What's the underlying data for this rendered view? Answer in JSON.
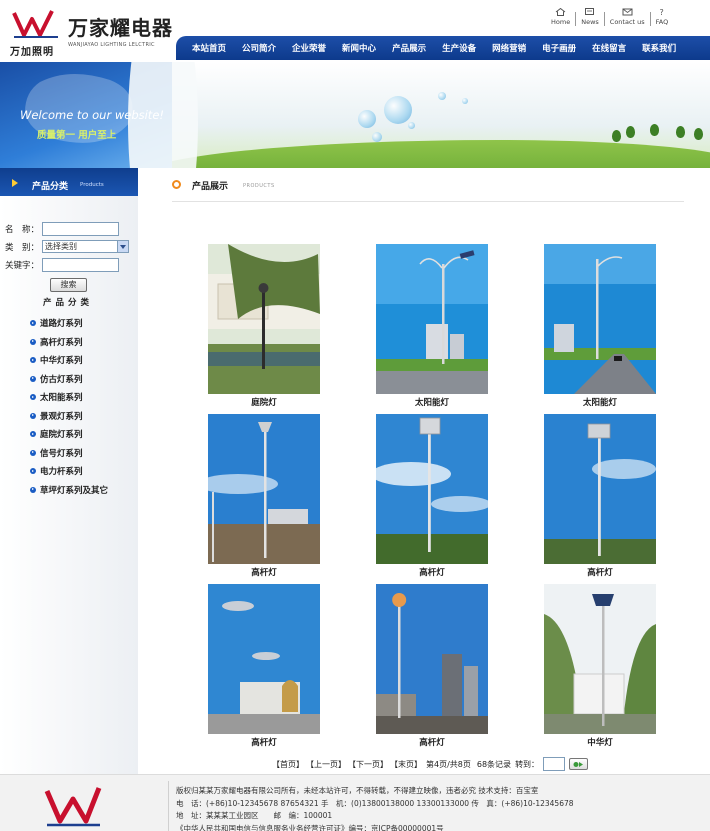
{
  "brand": {
    "name_cn": "万家耀电器",
    "name_en": "WANJIAYAO LIGHTING LELCTRIC",
    "sub_cn": "万加照明",
    "accent": "#0d3a8c",
    "logo_red": "#c8102e"
  },
  "top_links": [
    "Home",
    "News",
    "Contact us",
    "FAQ"
  ],
  "nav": [
    "本站首页",
    "公司简介",
    "企业荣誉",
    "新闻中心",
    "产品展示",
    "生产设备",
    "网络营销",
    "电子画册",
    "在线留言",
    "联系我们"
  ],
  "banner": {
    "welcome": "Welcome to our website!",
    "slogan": "质量第一  用户至上"
  },
  "sidebar": {
    "header_cn": "产品分类",
    "header_en": "Products",
    "search": {
      "name_label": "名　称：",
      "name_value": "",
      "type_label": "类　别：",
      "type_value": "选择类别",
      "keyword_label": "关键字：",
      "keyword_value": "",
      "button": "搜索"
    },
    "category_title": "产品分类",
    "categories": [
      "道路灯系列",
      "高杆灯系列",
      "中华灯系列",
      "仿古灯系列",
      "太阳能系列",
      "景观灯系列",
      "庭院灯系列",
      "信号灯系列",
      "电力杆系列",
      "草坪灯系列及其它"
    ]
  },
  "main": {
    "title_cn": "产品展示",
    "title_en": "PRODUCTS",
    "products": [
      {
        "name": "庭院灯"
      },
      {
        "name": "太阳能灯"
      },
      {
        "name": "太阳能灯"
      },
      {
        "name": "高杆灯"
      },
      {
        "name": "高杆灯"
      },
      {
        "name": "高杆灯"
      },
      {
        "name": "高杆灯"
      },
      {
        "name": "高杆灯"
      },
      {
        "name": "中华灯"
      }
    ]
  },
  "pager": {
    "first": "【首页】",
    "prev": "【上一页】",
    "next": "【下一页】",
    "last": "【末页】",
    "status": "第4页/共8页",
    "records": "68条记录",
    "goto_label": "转到：",
    "page_value": ""
  },
  "footer": {
    "copyright": "版权归某某万家耀电器有限公司所有，未经本站许可，不得转载，不得建立映像，违者必究  技术支持：百宝室",
    "phone": "电　话：(+86)10-12345678  87654321  手　机：(0)13800138000  13300133000  传　真：(+86)10-12345678",
    "address": "地　址：某某某工业园区　　邮　编：100001",
    "icp": "《中华人民共和国电信与信息服务业务经营许可证》编号：京ICP备00000001号"
  }
}
